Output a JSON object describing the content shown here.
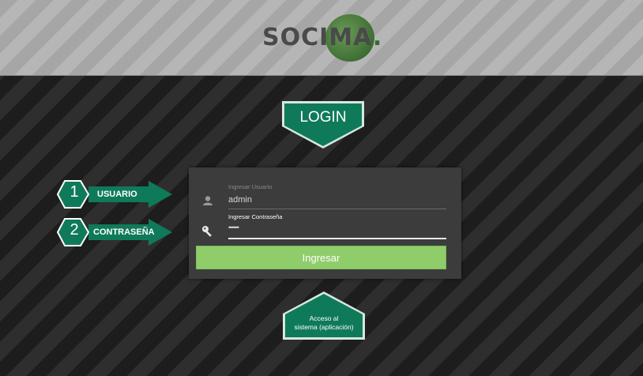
{
  "brand": {
    "logo_text": "SOCIMA",
    "logo_dot": "."
  },
  "badges": {
    "login": "LOGIN",
    "access_line1": "Acceso al",
    "access_line2": "sistema (aplicación)"
  },
  "steps": [
    {
      "number": "1",
      "label": "USUARIO"
    },
    {
      "number": "2",
      "label": "CONTRASEÑA"
    }
  ],
  "form": {
    "user_label": "Ingresar Usuario",
    "user_value": "admin",
    "password_label": "Ingresar Contraseña",
    "password_value": "••••••",
    "submit_label": "Ingresar"
  },
  "colors": {
    "accent_green": "#0f7a5a",
    "button_green": "#8fcd6a",
    "panel": "#3c3c3c"
  },
  "icons": {
    "user": "user-icon",
    "password": "key-icon"
  }
}
